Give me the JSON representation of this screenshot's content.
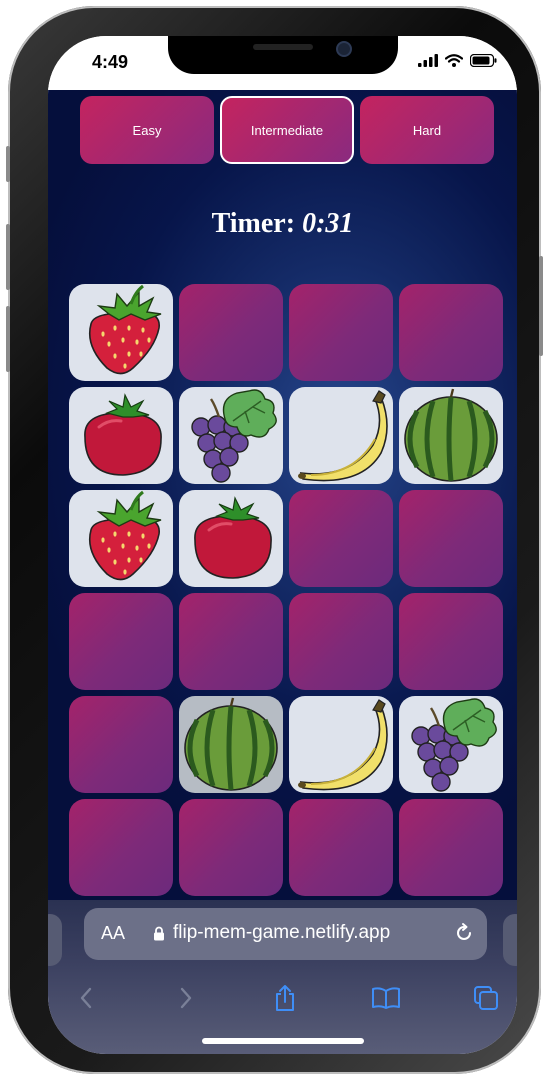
{
  "status_bar": {
    "time": "4:49"
  },
  "difficulty": {
    "options": [
      {
        "label": "Easy",
        "active": false
      },
      {
        "label": "Intermediate",
        "active": true
      },
      {
        "label": "Hard",
        "active": false
      }
    ]
  },
  "timer": {
    "label": "Timer:",
    "value": "0:31"
  },
  "board": {
    "columns": 4,
    "rows": 6,
    "cards": [
      "strawberry",
      "hidden",
      "hidden",
      "hidden",
      "tomato",
      "grapes",
      "banana",
      "watermelon",
      "strawberry",
      "tomato",
      "hidden",
      "hidden",
      "hidden",
      "hidden",
      "hidden",
      "hidden",
      "hidden",
      "watermelon",
      "banana",
      "grapes",
      "hidden",
      "hidden",
      "hidden",
      "hidden"
    ]
  },
  "browser": {
    "text_size_label": "AA",
    "url": "flip-mem-game.netlify.app"
  }
}
